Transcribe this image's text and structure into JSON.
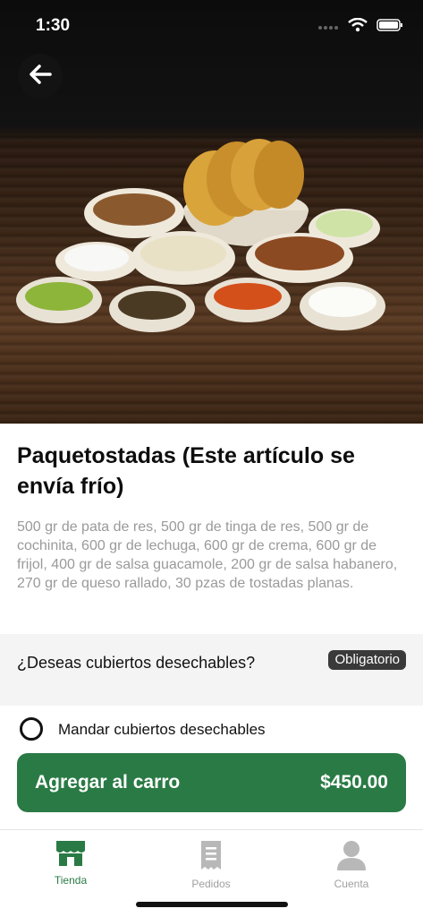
{
  "status_bar": {
    "time": "1:30"
  },
  "product": {
    "title": "Paquetostadas (Este artículo se envía frío)",
    "description": "500 gr de pata de res, 500 gr de tinga de res, 500 gr de cochinita, 600 gr de lechuga, 600 gr de crema, 600 gr de frijol, 400 gr de salsa guacamole, 200 gr de salsa habanero, 270 gr de queso rallado, 30 pzas de tostadas planas."
  },
  "cutlery": {
    "question": "¿Deseas cubiertos desechables?",
    "badge": "Obligatorio",
    "option_label": "Mandar cubiertos desechables"
  },
  "cart_button": {
    "label": "Agregar al carro",
    "price": "$450.00"
  },
  "tabs": [
    {
      "label": "Tienda",
      "icon": "store-icon",
      "active": true
    },
    {
      "label": "Pedidos",
      "icon": "receipt-icon",
      "active": false
    },
    {
      "label": "Cuenta",
      "icon": "user-icon",
      "active": false
    }
  ],
  "colors": {
    "accent": "#2a7a45",
    "badge": "#3a3a3a"
  }
}
